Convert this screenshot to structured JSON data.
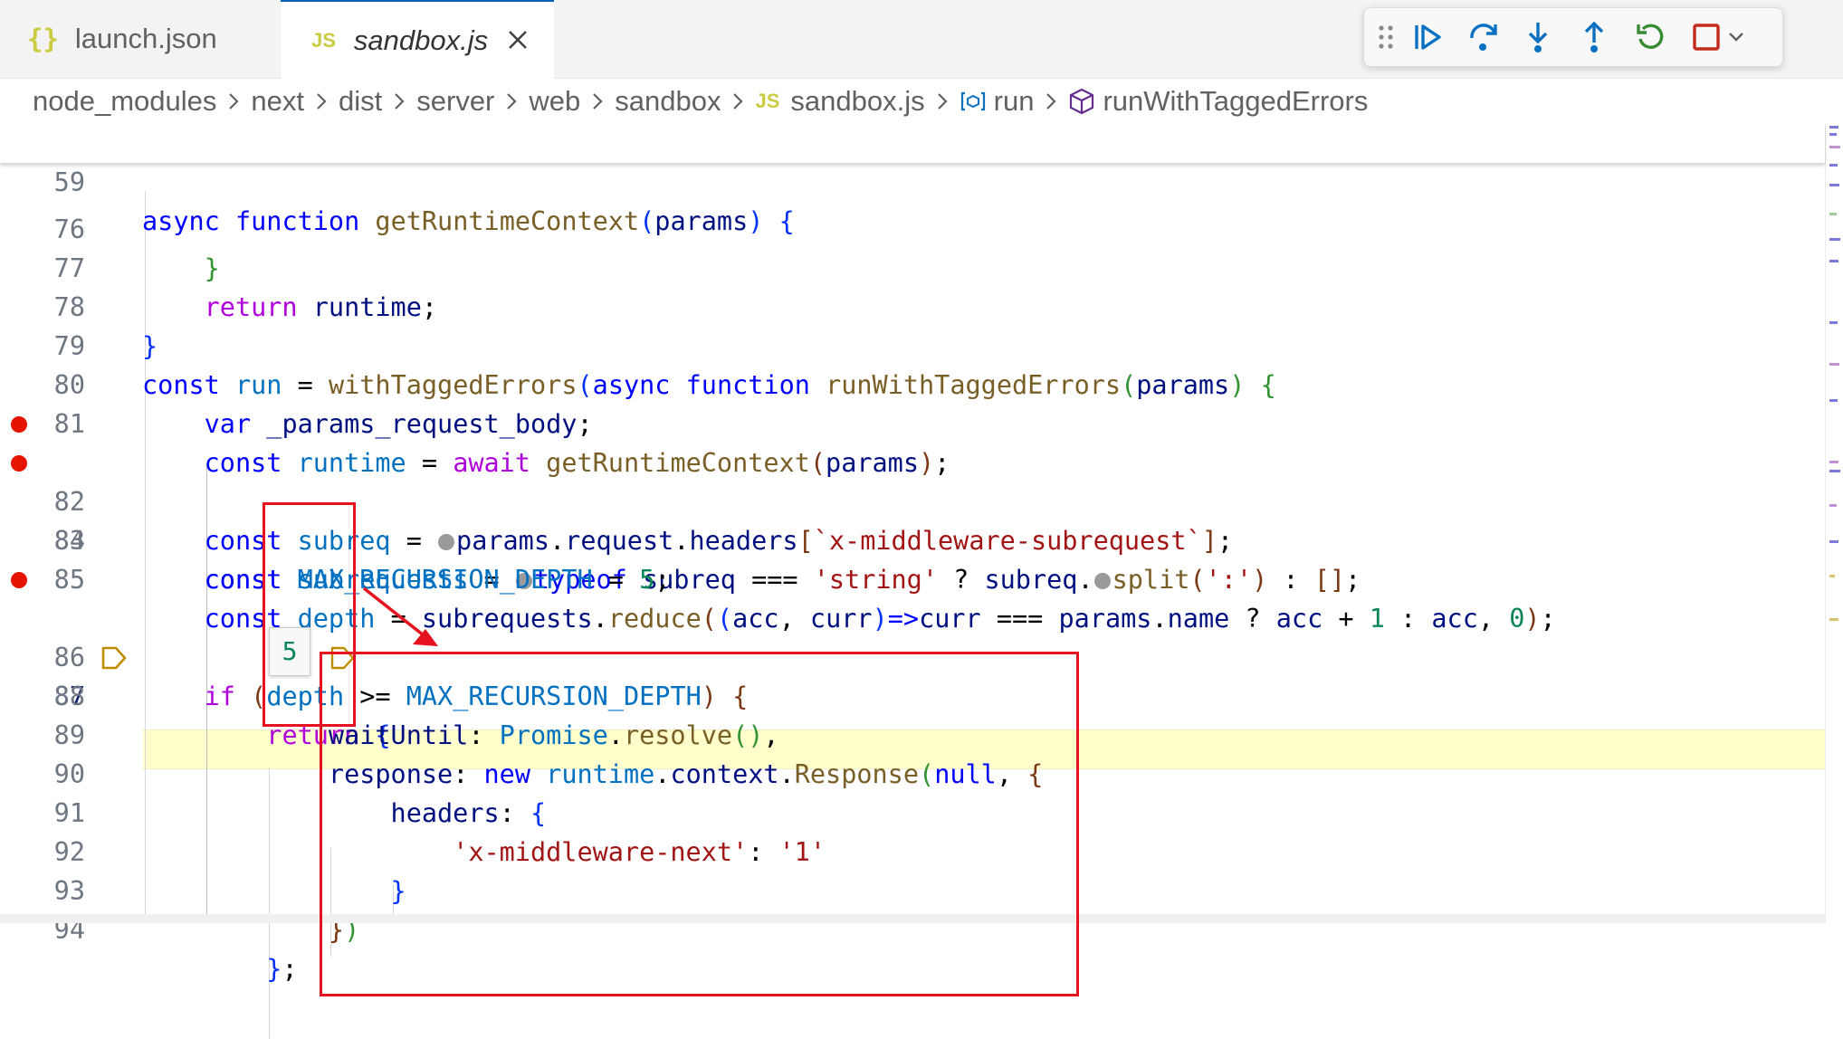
{
  "tabs": [
    {
      "icon": "{}",
      "label": "launch.json"
    },
    {
      "icon": "JS",
      "label": "sandbox.js",
      "close": "✕"
    }
  ],
  "breadcrumb": {
    "folders": [
      "node_modules",
      "next",
      "dist",
      "server",
      "web",
      "sandbox"
    ],
    "file_icon": "JS",
    "file": "sandbox.js",
    "variable": "run",
    "function": "runWithTaggedErrors"
  },
  "debug_toolbar": [
    "drag-handle",
    "continue",
    "step-over",
    "step-into",
    "step-out",
    "restart",
    "stop",
    "more-options"
  ],
  "sticky_line": {
    "number": "59"
  },
  "lines": [
    {
      "number": "76"
    },
    {
      "number": "77"
    },
    {
      "number": "78"
    },
    {
      "number": "79"
    },
    {
      "number": "80"
    },
    {
      "number": "81"
    },
    {
      "number": "82",
      "breakpoint": true
    },
    {
      "number": "83",
      "breakpoint": true
    },
    {
      "number": "84"
    },
    {
      "number": "85"
    },
    {
      "number": "86",
      "breakpoint": true
    },
    {
      "number": "87",
      "current": true
    },
    {
      "number": "88"
    },
    {
      "number": "89"
    },
    {
      "number": "90"
    },
    {
      "number": "91"
    },
    {
      "number": "92"
    },
    {
      "number": "93"
    },
    {
      "number": "94"
    }
  ],
  "hover_value": "5",
  "colors": {
    "keyword": "#0000ff",
    "control": "#af00db",
    "function": "#795e26",
    "variable": "#001080",
    "constant": "#0070c1",
    "string": "#a31515",
    "number": "#098658",
    "breakpoint": "#e51400",
    "current_line": "#ffffcc",
    "annotation": "#e6121f"
  }
}
